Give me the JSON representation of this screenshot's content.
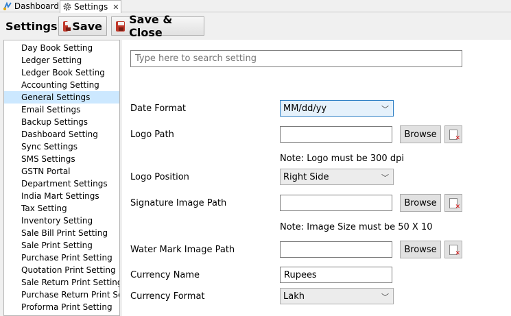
{
  "tabs": [
    {
      "label": "Dashboard",
      "icon": "dashboard-icon"
    },
    {
      "label": "Settings",
      "icon": "gear-icon",
      "active": true
    }
  ],
  "toolbar": {
    "title": "Settings:",
    "save_label": "Save",
    "save_close_label": "Save & Close"
  },
  "sidebar": {
    "items": [
      "Day Book Setting",
      "Ledger Setting",
      "Ledger Book Setting",
      "Accounting Setting",
      "General Settings",
      "Email Settings",
      "Backup Settings",
      "Dashboard Setting",
      "Sync Settings",
      "SMS Settings",
      "GSTN Portal",
      "Department Settings",
      "India Mart Settings",
      "Tax Setting",
      "Inventory Setting",
      "Sale Bill Print Setting",
      "Sale Print Setting",
      "Purchase Print Setting",
      "Quotation Print Setting",
      "Sale Return Print Setting",
      "Purchase Return Print Setting",
      "Proforma Print Setting"
    ],
    "selected": "General Settings"
  },
  "main": {
    "search_placeholder": "Type here to search setting",
    "date_format": {
      "label": "Date Format",
      "value": "MM/dd/yy"
    },
    "logo_path": {
      "label": "Logo Path",
      "value": "",
      "browse": "Browse",
      "note": "Note: Logo must be 300 dpi"
    },
    "logo_position": {
      "label": "Logo Position",
      "value": "Right Side"
    },
    "signature_path": {
      "label": "Signature Image Path",
      "value": "",
      "browse": "Browse",
      "note": "Note: Image Size must be 50 X 10"
    },
    "watermark_path": {
      "label": "Water Mark Image Path",
      "value": "",
      "browse": "Browse"
    },
    "currency_name": {
      "label": "Currency Name",
      "value": "Rupees"
    },
    "currency_format": {
      "label": "Currency Format",
      "value": "Lakh"
    }
  }
}
